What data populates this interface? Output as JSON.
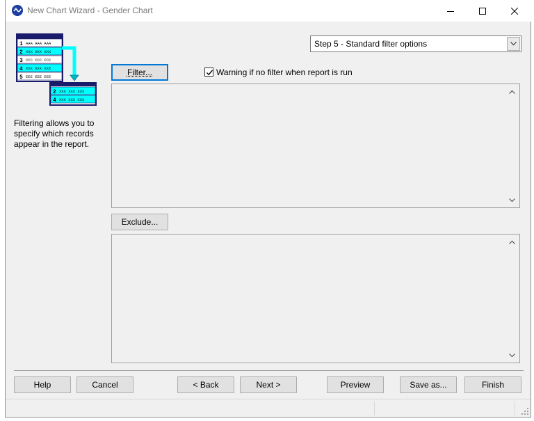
{
  "window": {
    "title": "New Chart Wizard - Gender Chart",
    "controls": [
      "minimize-icon",
      "maximize-icon",
      "close-icon"
    ]
  },
  "step_select": {
    "value": "Step 5 - Standard filter options"
  },
  "graphic": {
    "rows": [
      {
        "num": "1",
        "text": "AAA AAA AAA"
      },
      {
        "num": "2",
        "text": "XXX XXX XXX"
      },
      {
        "num": "3",
        "text": "CCC CCC CCC"
      },
      {
        "num": "4",
        "text": "XXX XXX XXX"
      },
      {
        "num": "5",
        "text": "EEE EEE EEE"
      }
    ],
    "result_rows": [
      {
        "num": "2",
        "text": "XXX XXX XXX"
      },
      {
        "num": "4",
        "text": "XXX XXX XXX"
      }
    ]
  },
  "side": {
    "description": "Filtering allows you to specify which records appear in the report."
  },
  "filter": {
    "button_label": "Filter...",
    "warning_label": "Warning if no filter when report is run",
    "warning_checked": true
  },
  "exclude": {
    "button_label": "Exclude..."
  },
  "footer": {
    "help": "Help",
    "cancel": "Cancel",
    "back": "< Back",
    "next": "Next >",
    "preview": "Preview",
    "save_as": "Save as...",
    "finish": "Finish"
  },
  "colors": {
    "accent": "#0078d7",
    "graphic_highlight": "#00ffff",
    "graphic_header": "#1b1b6b"
  }
}
